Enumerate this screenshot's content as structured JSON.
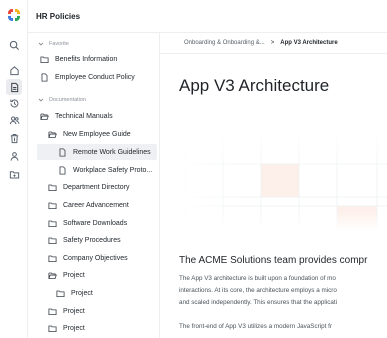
{
  "header": {
    "title": "HR Policies"
  },
  "brand": {
    "colors": [
      "#e8453c",
      "#f6b51e",
      "#2fa65a",
      "#3d7be0"
    ]
  },
  "rail": {
    "icons": [
      "search-icon",
      "home-icon",
      "document-icon",
      "history-icon",
      "users-icon",
      "trash-icon",
      "person-icon",
      "folder-icon"
    ],
    "active_index": 2
  },
  "sidebar": {
    "favorite_label": "Favorite",
    "favorites": [
      "Benefits Information",
      "Employee Conduct Policy"
    ],
    "documentation_label": "Documentation",
    "tree": [
      {
        "label": "Technical Manuals",
        "icon": "folder-open-icon"
      },
      {
        "label": "New Employee Guide",
        "icon": "folder-open-icon"
      },
      {
        "label": "Remote Work Guidelines",
        "icon": "file-icon",
        "selected": true
      },
      {
        "label": "Workplace Safety Proto...",
        "icon": "file-icon"
      },
      {
        "label": "Department Directory",
        "icon": "folder-icon"
      },
      {
        "label": "Career Advancement",
        "icon": "folder-icon"
      },
      {
        "label": "Software Downloads",
        "icon": "folder-icon"
      },
      {
        "label": "Safety Procedures",
        "icon": "folder-icon"
      },
      {
        "label": "Company Objectives",
        "icon": "folder-icon"
      },
      {
        "label": "Project",
        "icon": "folder-open-icon"
      },
      {
        "label": "Project",
        "icon": "folder-icon"
      },
      {
        "label": "Project",
        "icon": "folder-icon"
      },
      {
        "label": "Project",
        "icon": "folder-icon"
      }
    ]
  },
  "breadcrumb": {
    "parent": "Onboarding & Onboarding &...",
    "separator": ">",
    "current": "App V3 Architecture"
  },
  "article": {
    "title": "App V3 Architecture",
    "heading": "The ACME Solutions team provides compr",
    "para1": [
      "The App V3 architecture is built upon a foundation of mo",
      "interactions. At its core, the architecture employs a micro",
      "and scaled independently. This ensures that the applicati"
    ],
    "para2": [
      "The front-end of App V3 utilizes a modern JavaScript fr"
    ]
  }
}
